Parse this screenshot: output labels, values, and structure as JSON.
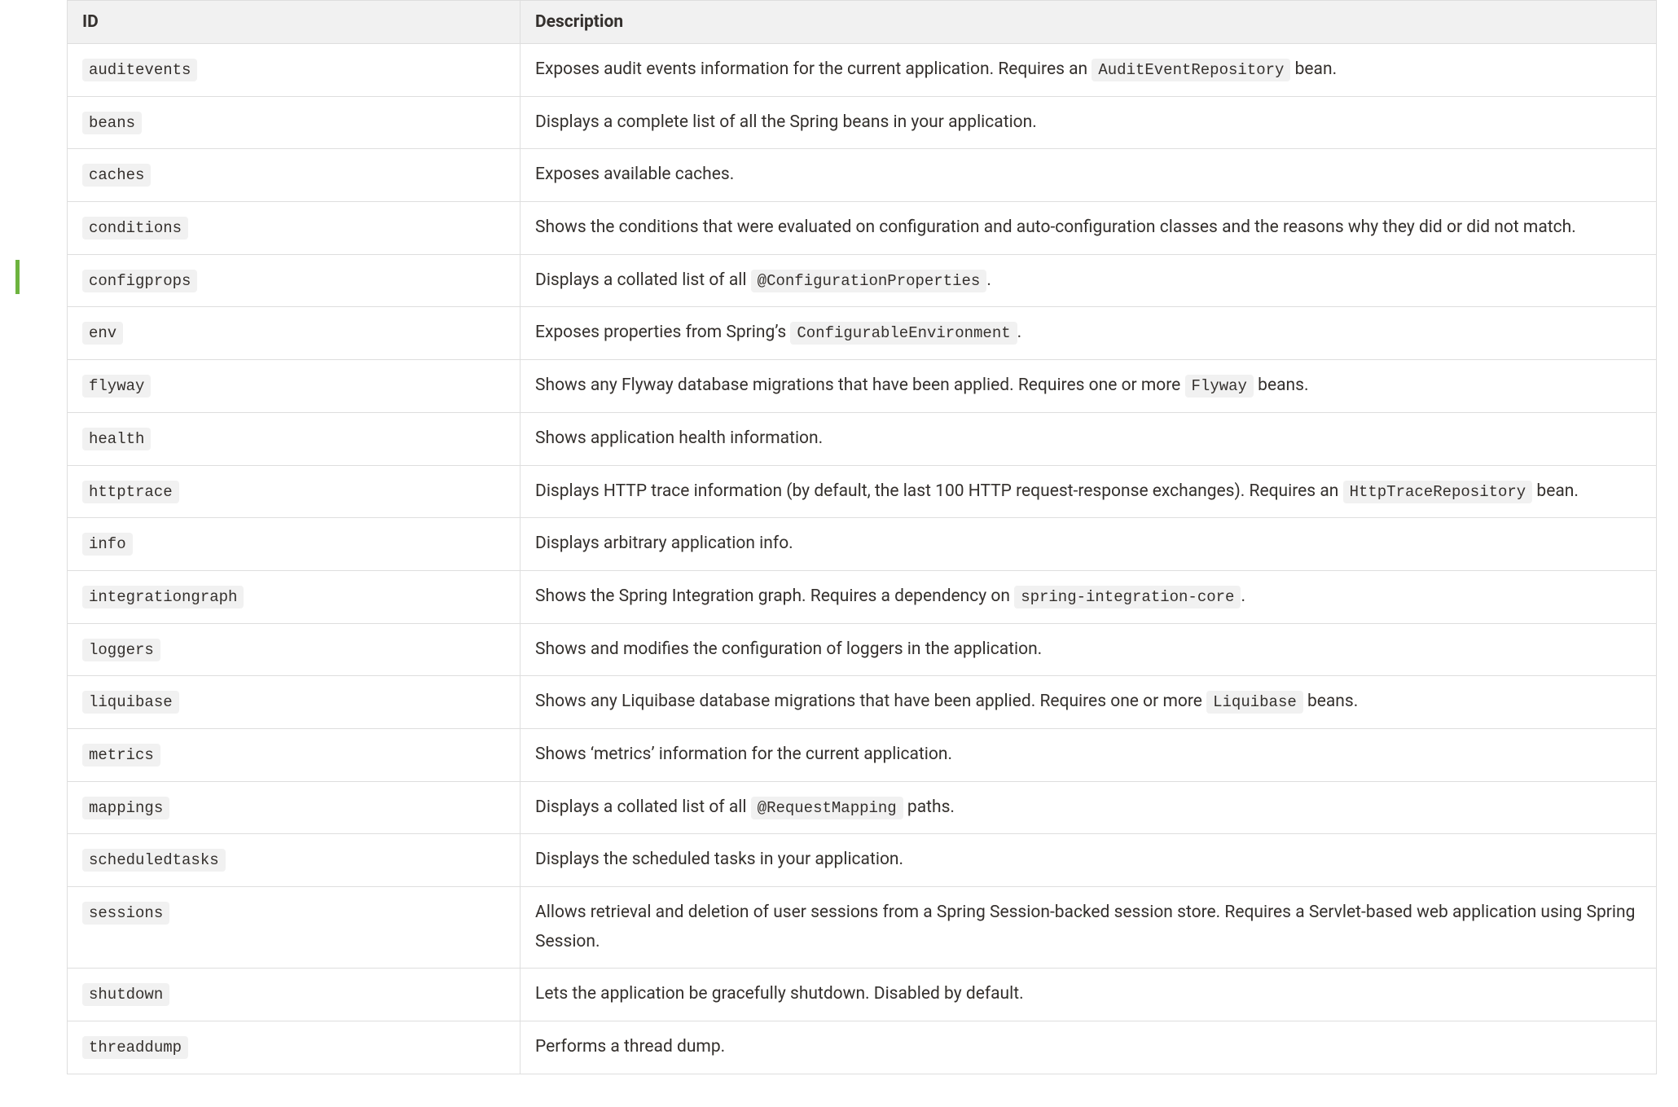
{
  "table": {
    "headers": {
      "id": "ID",
      "description": "Description"
    },
    "rows": [
      {
        "id": "auditevents",
        "desc": [
          {
            "t": "text",
            "v": "Exposes audit events information for the current application. Requires an "
          },
          {
            "t": "code",
            "v": "AuditEventRepository"
          },
          {
            "t": "text",
            "v": " bean."
          }
        ]
      },
      {
        "id": "beans",
        "desc": [
          {
            "t": "text",
            "v": "Displays a complete list of all the Spring beans in your application."
          }
        ]
      },
      {
        "id": "caches",
        "desc": [
          {
            "t": "text",
            "v": "Exposes available caches."
          }
        ]
      },
      {
        "id": "conditions",
        "desc": [
          {
            "t": "text",
            "v": "Shows the conditions that were evaluated on configuration and auto-configuration classes and the reasons why they did or did not match."
          }
        ]
      },
      {
        "id": "configprops",
        "desc": [
          {
            "t": "text",
            "v": "Displays a collated list of all "
          },
          {
            "t": "code",
            "v": "@ConfigurationProperties"
          },
          {
            "t": "text",
            "v": "."
          }
        ]
      },
      {
        "id": "env",
        "desc": [
          {
            "t": "text",
            "v": "Exposes properties from Spring’s "
          },
          {
            "t": "code",
            "v": "ConfigurableEnvironment"
          },
          {
            "t": "text",
            "v": "."
          }
        ]
      },
      {
        "id": "flyway",
        "desc": [
          {
            "t": "text",
            "v": "Shows any Flyway database migrations that have been applied. Requires one or more "
          },
          {
            "t": "code",
            "v": "Flyway"
          },
          {
            "t": "text",
            "v": " beans."
          }
        ]
      },
      {
        "id": "health",
        "desc": [
          {
            "t": "text",
            "v": "Shows application health information."
          }
        ]
      },
      {
        "id": "httptrace",
        "desc": [
          {
            "t": "text",
            "v": "Displays HTTP trace information (by default, the last 100 HTTP request-response exchanges). Requires an "
          },
          {
            "t": "code",
            "v": "HttpTraceRepository"
          },
          {
            "t": "text",
            "v": " bean."
          }
        ]
      },
      {
        "id": "info",
        "desc": [
          {
            "t": "text",
            "v": "Displays arbitrary application info."
          }
        ]
      },
      {
        "id": "integrationgraph",
        "desc": [
          {
            "t": "text",
            "v": "Shows the Spring Integration graph. Requires a dependency on "
          },
          {
            "t": "code",
            "v": "spring-integration-core"
          },
          {
            "t": "text",
            "v": "."
          }
        ]
      },
      {
        "id": "loggers",
        "desc": [
          {
            "t": "text",
            "v": "Shows and modifies the configuration of loggers in the application."
          }
        ]
      },
      {
        "id": "liquibase",
        "desc": [
          {
            "t": "text",
            "v": "Shows any Liquibase database migrations that have been applied. Requires one or more "
          },
          {
            "t": "code",
            "v": "Liquibase"
          },
          {
            "t": "text",
            "v": " beans."
          }
        ]
      },
      {
        "id": "metrics",
        "desc": [
          {
            "t": "text",
            "v": "Shows ‘metrics’ information for the current application."
          }
        ]
      },
      {
        "id": "mappings",
        "desc": [
          {
            "t": "text",
            "v": "Displays a collated list of all "
          },
          {
            "t": "code",
            "v": "@RequestMapping"
          },
          {
            "t": "text",
            "v": " paths."
          }
        ]
      },
      {
        "id": "scheduledtasks",
        "desc": [
          {
            "t": "text",
            "v": "Displays the scheduled tasks in your application."
          }
        ]
      },
      {
        "id": "sessions",
        "desc": [
          {
            "t": "text",
            "v": "Allows retrieval and deletion of user sessions from a Spring Session-backed session store. Requires a Servlet-based web application using Spring Session."
          }
        ]
      },
      {
        "id": "shutdown",
        "desc": [
          {
            "t": "text",
            "v": "Lets the application be gracefully shutdown. Disabled by default."
          }
        ]
      },
      {
        "id": "threaddump",
        "desc": [
          {
            "t": "text",
            "v": "Performs a thread dump."
          }
        ]
      }
    ]
  }
}
